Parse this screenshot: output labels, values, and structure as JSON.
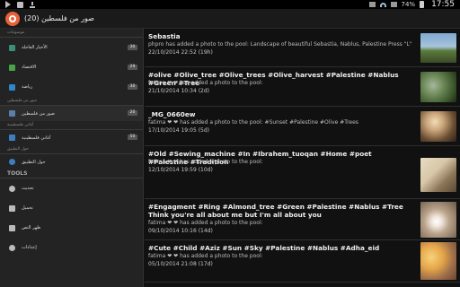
{
  "status_bar": {
    "left_icons": [
      "play-store-icon",
      "gallery-icon",
      "download-icon"
    ],
    "battery": "74%",
    "time": "17:55"
  },
  "action_bar": {
    "title": "صور من فلسطين (20)",
    "icon": "app-logo-icon",
    "accent_color": "#e8623a"
  },
  "drawer": {
    "sections": [
      {
        "header": "موضوعات",
        "items": [
          {
            "label": "الأخبار العاجلة",
            "count": "30",
            "icon": "news-icon",
            "color": "#3a8e7a"
          },
          {
            "label": "الاقتصاد",
            "count": "29",
            "icon": "dollar-icon",
            "color": "#47a447"
          },
          {
            "label": "رياضة",
            "count": "30",
            "icon": "sports-icon",
            "color": "#2f86c8"
          }
        ]
      },
      {
        "header": "صور من فلسطين",
        "items": [
          {
            "label": "صور من فلسطين",
            "count": "20",
            "icon": "gallery-item-icon",
            "color": "#5a7fa8"
          }
        ]
      },
      {
        "header": "أغاني فلسطينية",
        "items": [
          {
            "label": "أغاني فلسطينية",
            "count": "50",
            "icon": "music-icon",
            "color": "#3b7fc0"
          }
        ]
      },
      {
        "header": "حول التطبيق",
        "items": [
          {
            "label": "حول التطبيق",
            "count": "",
            "icon": "info-icon",
            "color": "#3b7fc0"
          }
        ]
      }
    ],
    "tools": {
      "header": "TOOLS",
      "items": [
        {
          "label": "تحديث",
          "icon": "refresh-icon",
          "color": "#bbbbbb"
        },
        {
          "label": "تحميل",
          "icon": "save-icon",
          "color": "#bbbbbb"
        },
        {
          "label": "ظهر النص",
          "icon": "text-icon",
          "color": "#bbbbbb"
        },
        {
          "label": "إعدادات",
          "icon": "settings-icon",
          "color": "#bbbbbb"
        }
      ]
    }
  },
  "feed": {
    "posts": [
      {
        "title": "Sebastia",
        "body": "phpro has added a photo to the pool: Landscape of beautiful Sebastia, Nablus, Palestine Press \"L\"",
        "date": "22/10/2014 22:52 (19h)",
        "thumb_colors": [
          "#7fa8d0",
          "#5a7a3a"
        ]
      },
      {
        "title": "#olive #Olive_tree #Olive_trees #Olive_harvest #Palestine #Nablus #Green #Tree",
        "body": "fatima ❤ ❤ has added a photo to the pool:",
        "date": "21/10/2014 10:34 (2d)",
        "thumb_colors": [
          "#3e5a2e",
          "#a7b79b"
        ]
      },
      {
        "title": "_MG_0660ew",
        "body": "fatima ❤ ❤ has added a photo to the pool: #Sunset #Palestine #Olive #Trees",
        "date": "17/10/2014 19:05 (5d)",
        "thumb_colors": [
          "#c9a47a",
          "#2a2018"
        ]
      },
      {
        "title": "#Old #Sewing_machine #In #Ibrahem_tuoqan #Home #poet #Palestine #Tradition",
        "body": "fatima ❤ ❤ has added a photo to the pool:",
        "date": "12/10/2014 19:59 (10d)",
        "thumb_colors": [
          "#d8c7a8",
          "#5a4a34"
        ]
      },
      {
        "title": "#Engagment #Ring #Almond_tree #Green #Palestine #Nablus #Tree Think you're all about me but I'm all about you",
        "body": "fatima ❤ ❤ has added a photo to the pool:",
        "date": "09/10/2014 10:16 (14d)",
        "thumb_colors": [
          "#b9a28a",
          "#ffffff"
        ]
      },
      {
        "title": "#Cute #Child #Aziz #Sun #Sky #Palestine #Nablus #Adha_eid",
        "body": "fatima ❤ ❤ has added a photo to the pool:",
        "date": "05/10/2014 21:08 (17d)",
        "thumb_colors": [
          "#e6a64a",
          "#6a4630"
        ]
      }
    ]
  }
}
